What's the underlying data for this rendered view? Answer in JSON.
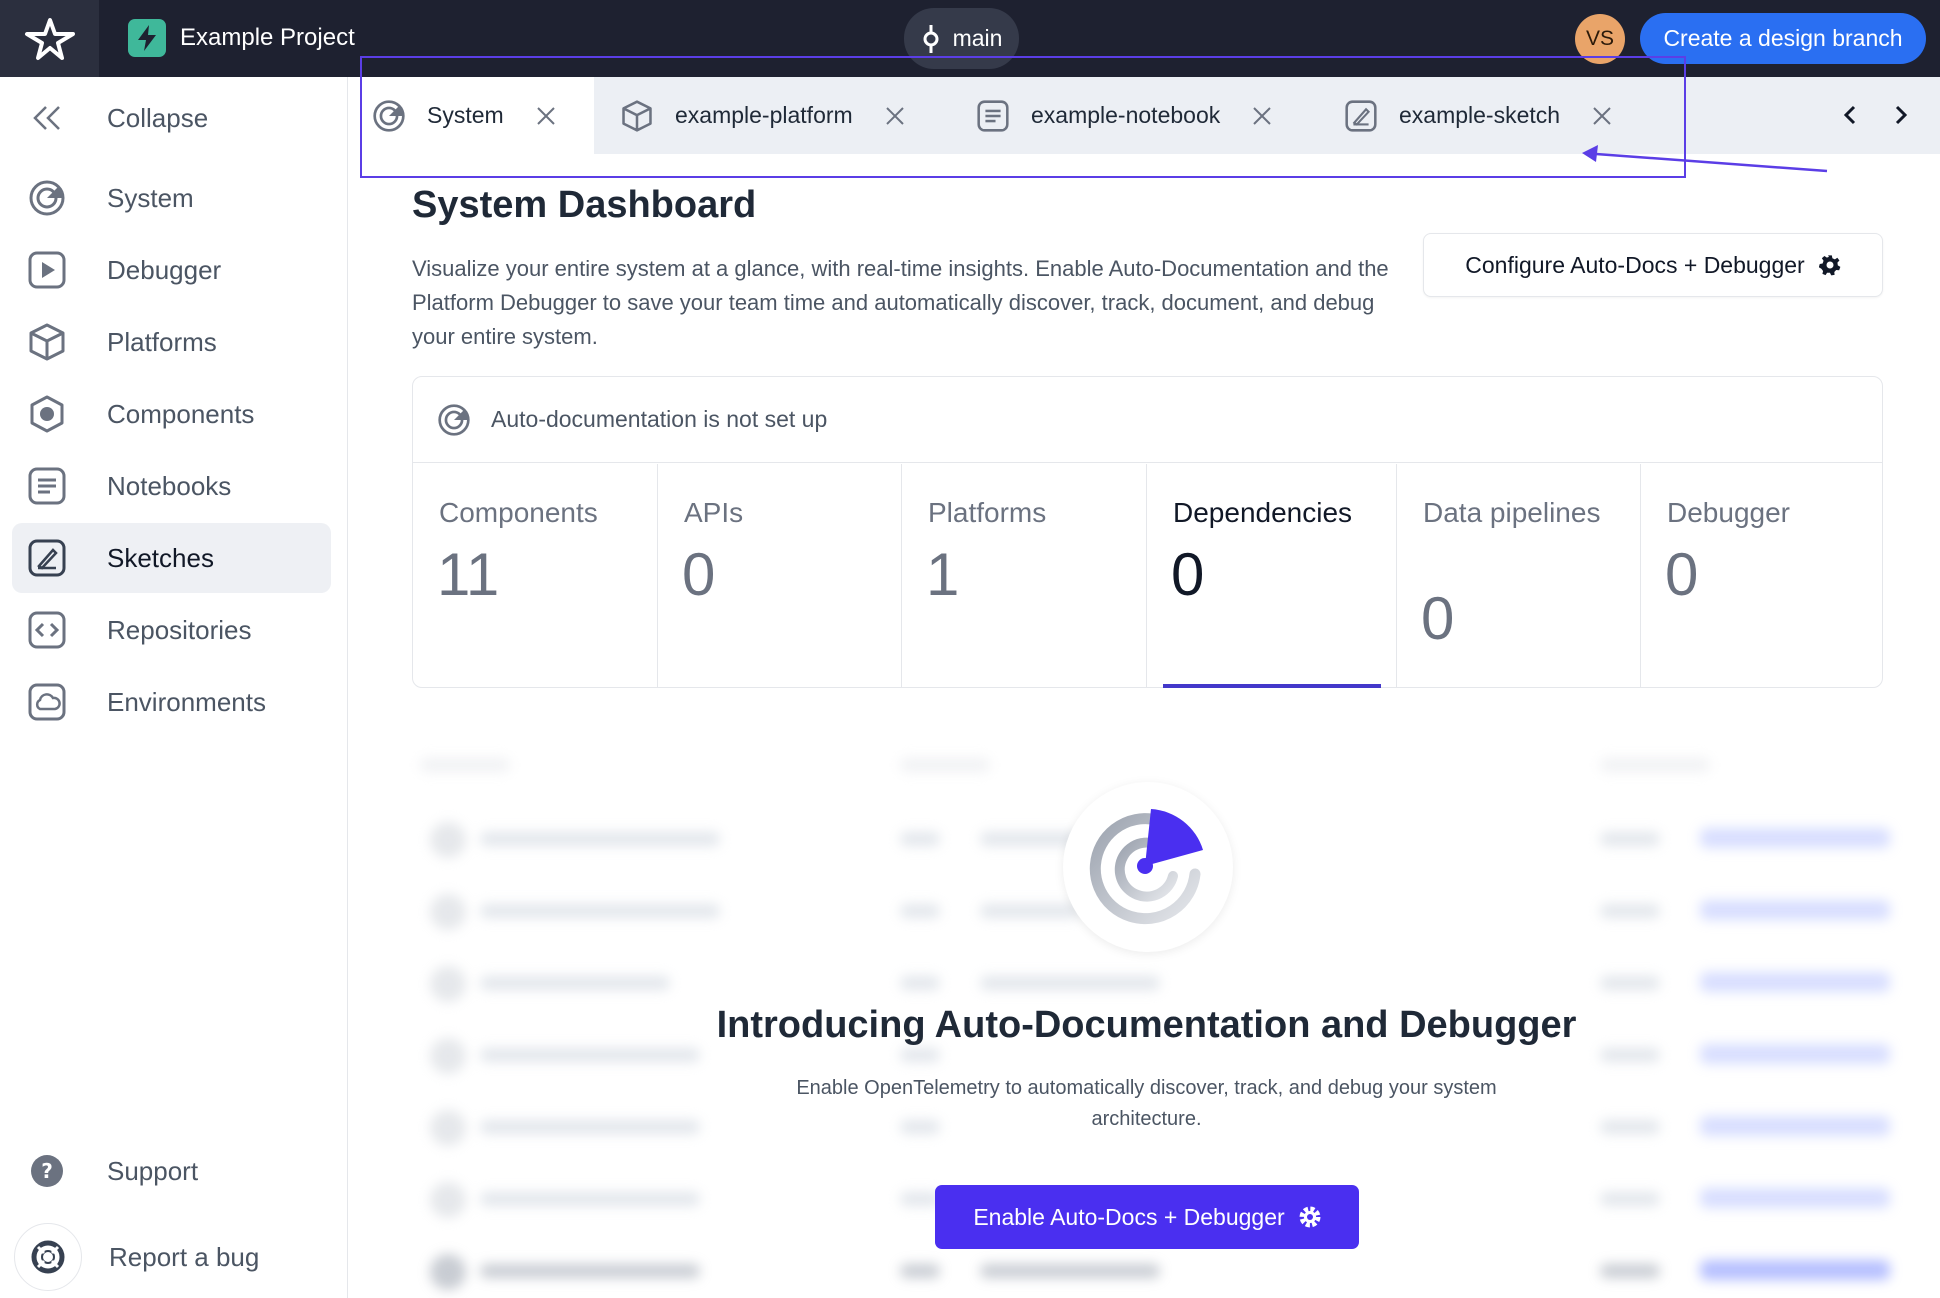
{
  "topbar": {
    "project_name": "Example Project",
    "branch": "main",
    "avatar_initials": "VS",
    "create_button": "Create a design branch"
  },
  "sidebar": {
    "collapse": "Collapse",
    "items": [
      {
        "label": "System",
        "icon": "system-icon"
      },
      {
        "label": "Debugger",
        "icon": "play-icon"
      },
      {
        "label": "Platforms",
        "icon": "cube-icon"
      },
      {
        "label": "Components",
        "icon": "component-icon"
      },
      {
        "label": "Notebooks",
        "icon": "notebook-icon"
      },
      {
        "label": "Sketches",
        "icon": "sketch-icon",
        "active": true
      },
      {
        "label": "Repositories",
        "icon": "code-icon"
      },
      {
        "label": "Environments",
        "icon": "cloud-icon"
      }
    ],
    "support": "Support",
    "report_bug": "Report a bug"
  },
  "tabs": [
    {
      "label": "System",
      "active": true
    },
    {
      "label": "example-platform"
    },
    {
      "label": "example-notebook"
    },
    {
      "label": "example-sketch"
    }
  ],
  "main": {
    "title": "System Dashboard",
    "description": "Visualize your entire system at a glance, with real-time insights. Enable Auto-Documentation and the Platform Debugger to save your team time and automatically discover, track, document, and debug your entire system.",
    "config_button": "Configure Auto-Docs + Debugger",
    "card_header": "Auto-documentation is not set up",
    "stats": [
      {
        "label": "Components",
        "value": "11"
      },
      {
        "label": "APIs",
        "value": "0"
      },
      {
        "label": "Platforms",
        "value": "1"
      },
      {
        "label": "Dependencies",
        "value": "0",
        "selected": true
      },
      {
        "label": "Data pipelines",
        "value": "0"
      },
      {
        "label": "Debugger",
        "value": "0"
      }
    ],
    "hero_title": "Introducing Auto-Documentation and Debugger",
    "hero_desc": "Enable OpenTelemetry to automatically discover, track, and debug your system architecture.",
    "enable_button": "Enable Auto-Docs + Debugger"
  },
  "colors": {
    "topbar": "#1e2130",
    "primary_blue": "#2a6ff2",
    "accent_indigo": "#4a2ff0",
    "annotation": "#5b3ee6"
  }
}
